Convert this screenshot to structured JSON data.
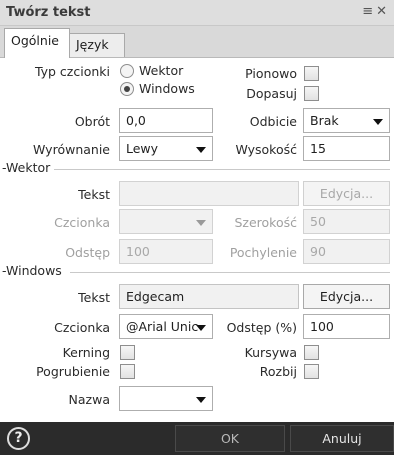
{
  "window": {
    "title": "Twórz tekst",
    "icons": [
      "pin-icon",
      "close-icon"
    ]
  },
  "tabs": [
    {
      "label": "Ogólnie"
    },
    {
      "label": "Język"
    }
  ],
  "general": {
    "font_type_label": "Typ czcionki",
    "radio_vector": "Wektor",
    "radio_windows": "Windows",
    "font_type_selected": "Windows",
    "vertical_label": "Pionowo",
    "fit_label": "Dopasuj",
    "rotation_label": "Obrót",
    "rotation_value": "0,0",
    "mirror_label": "Odbicie",
    "mirror_value": "Brak",
    "align_label": "Wyrównanie",
    "align_value": "Lewy",
    "height_label": "Wysokość",
    "height_value": "15"
  },
  "vector": {
    "section_label": "Wektor",
    "text_label": "Tekst",
    "text_value": "",
    "edit_button": "Edycja...",
    "font_label": "Czcionka",
    "font_value": "",
    "width_label": "Szerokość",
    "width_value": "50",
    "spacing_label": "Odstęp",
    "spacing_value": "100",
    "slant_label": "Pochylenie",
    "slant_value": "90"
  },
  "windows": {
    "section_label": "Windows",
    "text_label": "Tekst",
    "text_value": "Edgecam",
    "edit_button": "Edycja...",
    "font_label": "Czcionka",
    "font_value": "@Arial Unic",
    "spacing_label": "Odstęp (%)",
    "spacing_value": "100",
    "kerning_label": "Kerning",
    "italic_label": "Kursywa",
    "bold_label": "Pogrubienie",
    "explode_label": "Rozbij",
    "name_label": "Nazwa",
    "name_value": ""
  },
  "footer": {
    "help_glyph": "?",
    "ok_label": "OK",
    "cancel_label": "Anuluj"
  }
}
